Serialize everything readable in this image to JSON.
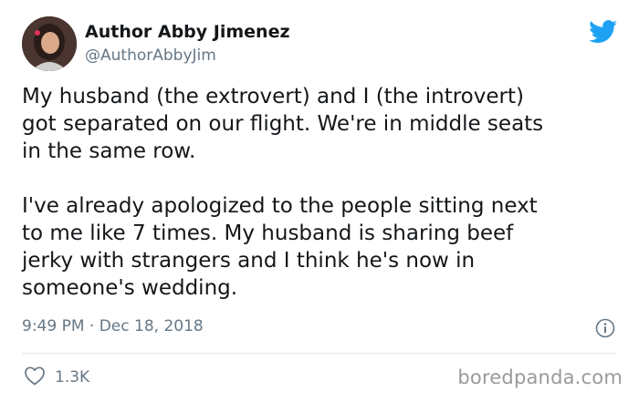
{
  "author": {
    "name": "Author Abby Jimenez",
    "handle": "@AuthorAbbyJim"
  },
  "tweet": {
    "paragraphs": [
      "My husband (the extrovert) and I (the introvert)\ngot separated on our flight. We're in middle seats\nin the same row.",
      "I've already apologized to the people sitting next\nto me like 7 times. My husband is sharing beef\njerky with strangers and I think he's now in\nsomeone's wedding."
    ],
    "timestamp": "9:49 PM · Dec 18, 2018",
    "likes": "1.3K"
  },
  "icons": {
    "platform": "twitter-bird-icon",
    "info": "info-icon",
    "like": "heart-icon"
  },
  "watermark": "boredpanda.com",
  "colors": {
    "twitter_blue": "#1da1f2",
    "text": "#14171a",
    "secondary_text": "#657786",
    "divider": "#e1e8ed"
  }
}
